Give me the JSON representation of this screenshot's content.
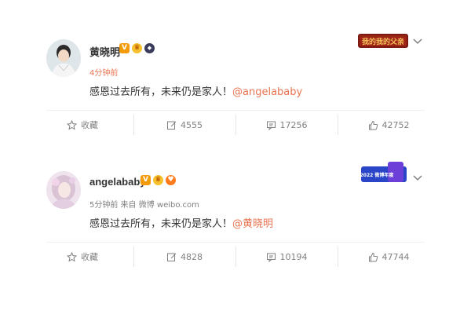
{
  "posts": [
    {
      "username": "黄晓明",
      "time": "4分钟前",
      "content_text": "感恩过去所有，未来仍是家人！",
      "mention": "@angelababy",
      "banner_text": "我的我的父亲",
      "actions": {
        "favorite": "收藏",
        "repost": "4555",
        "comment": "17256",
        "like": "42752"
      }
    },
    {
      "username": "angelababy",
      "time": "5分钟前 来自 微博 weibo.com",
      "content_text": "感恩过去所有，未来仍是家人！",
      "mention": "@黄晓明",
      "banner_text": "2022 微博年度",
      "actions": {
        "favorite": "收藏",
        "repost": "4828",
        "comment": "10194",
        "like": "47744"
      }
    }
  ],
  "colors": {
    "accent": "#eb7350",
    "text": "#333333",
    "muted": "#808080"
  }
}
